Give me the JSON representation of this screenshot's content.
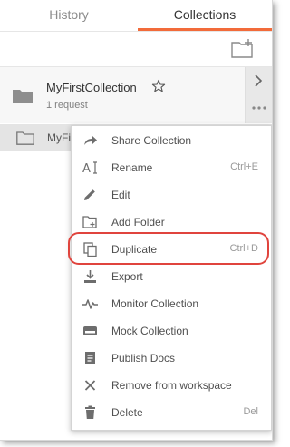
{
  "tabs": {
    "history": "History",
    "collections": "Collections"
  },
  "collection": {
    "name": "MyFirstCollection",
    "count": "1 request"
  },
  "subfolder": {
    "name": "MyFi"
  },
  "menu": {
    "items": [
      {
        "label": "Share Collection",
        "shortcut": "",
        "icon": "share-icon"
      },
      {
        "label": "Rename",
        "shortcut": "Ctrl+E",
        "icon": "rename-icon"
      },
      {
        "label": "Edit",
        "shortcut": "",
        "icon": "pencil-icon"
      },
      {
        "label": "Add Folder",
        "shortcut": "",
        "icon": "add-folder-icon"
      },
      {
        "label": "Duplicate",
        "shortcut": "Ctrl+D",
        "icon": "duplicate-icon"
      },
      {
        "label": "Export",
        "shortcut": "",
        "icon": "export-icon"
      },
      {
        "label": "Monitor Collection",
        "shortcut": "",
        "icon": "monitor-icon"
      },
      {
        "label": "Mock Collection",
        "shortcut": "",
        "icon": "mock-server-icon"
      },
      {
        "label": "Publish Docs",
        "shortcut": "",
        "icon": "docs-icon"
      },
      {
        "label": "Remove from workspace",
        "shortcut": "",
        "icon": "close-icon"
      },
      {
        "label": "Delete",
        "shortcut": "Del",
        "icon": "trash-icon"
      }
    ]
  },
  "colors": {
    "accent": "#f26b3a",
    "highlight": "#e0443d"
  }
}
